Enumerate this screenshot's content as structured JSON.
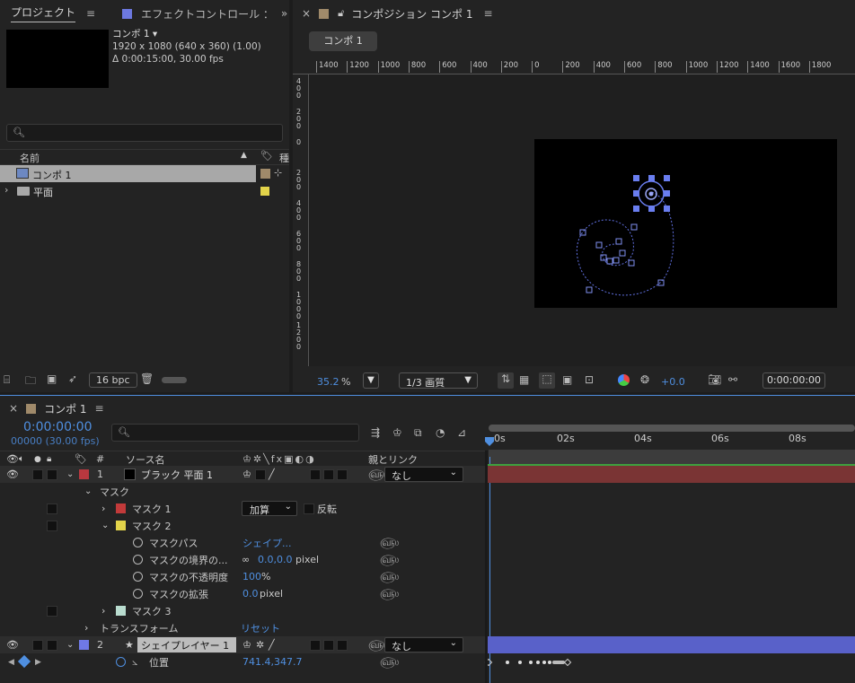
{
  "project": {
    "tab": "プロジェクト",
    "effects_tab": "エフェクトコントロール ：",
    "comp_name": "コンポ 1 ▾",
    "comp_res": "1920 x 1080  (640 x 360) (1.00)",
    "comp_dur": "Δ 0:00:15:00, 30.00 fps",
    "col_name": "名前",
    "col_type": "種",
    "items": [
      {
        "name": "コンポ 1",
        "color": "#a08a6a"
      },
      {
        "name": "平面",
        "color": "#e2d34a"
      }
    ],
    "bpc": "16 bpc"
  },
  "composition": {
    "tab": "コンポジション コンポ 1",
    "chip": "コンポ 1",
    "ruler_h": [
      "1400",
      "1200",
      "1000",
      "800",
      "600",
      "400",
      "200",
      "0",
      "200",
      "400",
      "600",
      "800",
      "1000",
      "1200",
      "1400",
      "1600",
      "1800"
    ],
    "ruler_v": [
      "400",
      "200",
      "0",
      "200",
      "400",
      "600",
      "800",
      "1000",
      "1200"
    ],
    "zoom": "35.2",
    "zoom_unit": "%",
    "resolution": "1/3 画質",
    "exposure": "+0.0",
    "timecode": "0:00:00:00"
  },
  "timeline": {
    "tab": "コンポ 1",
    "time": "0:00:00:00",
    "frames": "00000 (30.00 fps)",
    "col_source": "ソース名",
    "col_parent": "親とリンク",
    "col_num": "#",
    "ticks": [
      "0s",
      "02s",
      "04s",
      "06s",
      "08s"
    ],
    "layers": [
      {
        "num": "1",
        "name": "ブラック 平面 1",
        "parent": "なし",
        "color": "#b8383f"
      },
      {
        "num": "2",
        "name": "シェイプレイヤー 1",
        "parent": "なし",
        "color": "#6f79e6"
      }
    ],
    "mask_group": "マスク",
    "mask1": "マスク 1",
    "mask1_mode": "加算",
    "mask1_invert": "反転",
    "mask2": "マスク 2",
    "props": [
      {
        "label": "マスクパス",
        "value": "シェイプ..."
      },
      {
        "label": "マスクの境界の...",
        "value": "0.0,0.0",
        "unit": " pixel"
      },
      {
        "label": "マスクの不透明度",
        "value": "100",
        "unit": "%"
      },
      {
        "label": "マスクの拡張",
        "value": "0.0",
        "unit": " pixel"
      }
    ],
    "mask3": "マスク 3",
    "transform": "トランスフォーム",
    "reset": "リセット",
    "position_label": "位置",
    "position_value": "741.4,347.7",
    "colors": {
      "mask1": "#c23a3a",
      "mask2": "#e2d34a",
      "mask3": "#b9dccf",
      "accent": "#4f8fe0"
    }
  }
}
